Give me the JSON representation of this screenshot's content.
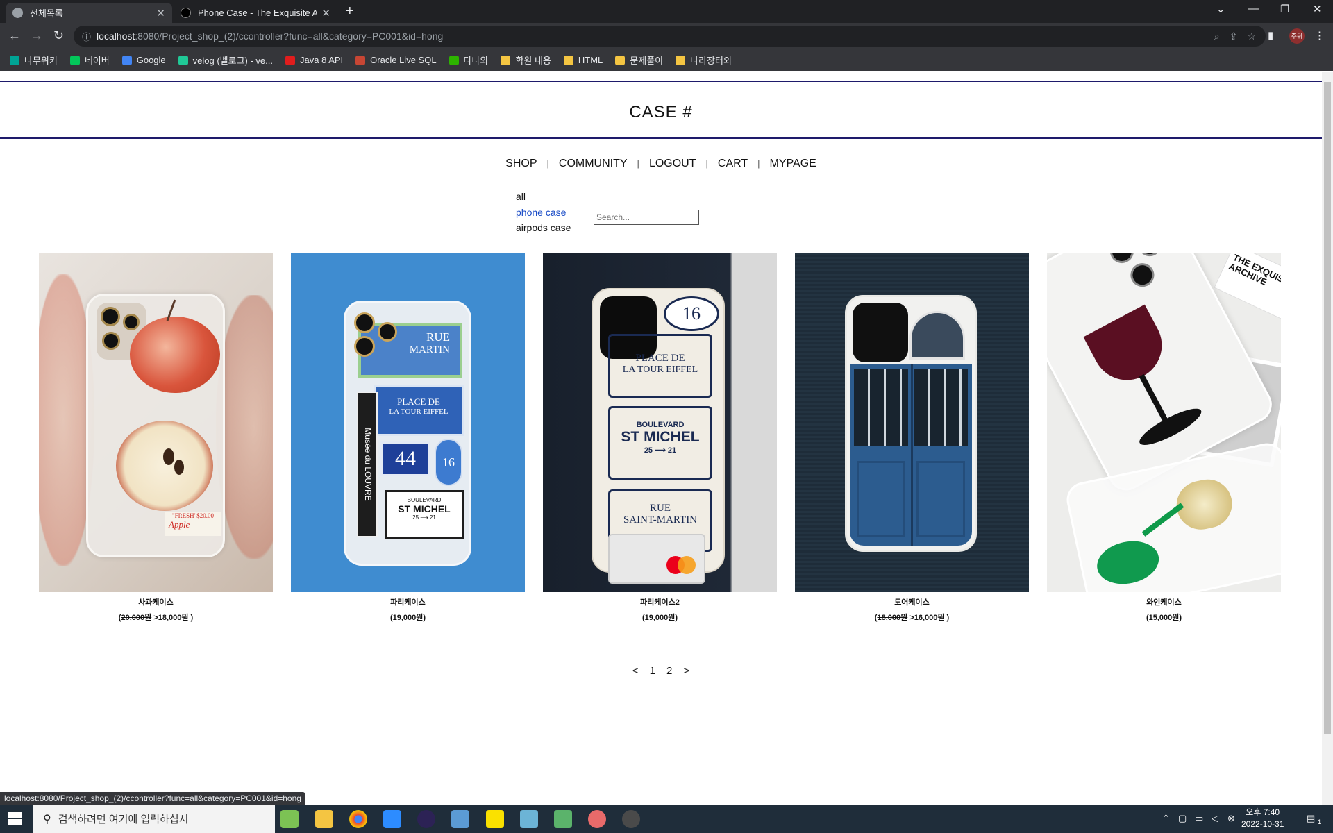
{
  "browser": {
    "tabs": [
      {
        "title": "전체목록",
        "active": true
      },
      {
        "title": "Phone Case - The Exquisite Arc",
        "active": false
      }
    ],
    "url_host": "localhost",
    "url_rest": ":8080/Project_shop_(2)/ccontroller?func=all&category=PC001&id=hong",
    "profile_label": "추워",
    "bookmarks": [
      {
        "label": "나무위키",
        "color": "#00a495"
      },
      {
        "label": "네이버",
        "color": "#03c75a"
      },
      {
        "label": "Google",
        "color": "#4285f4"
      },
      {
        "label": "velog (벨로그) - ve...",
        "color": "#20c997"
      },
      {
        "label": "Java 8 API",
        "color": "#e11d1d"
      },
      {
        "label": "Oracle Live SQL",
        "color": "#c74634"
      },
      {
        "label": "다나와",
        "color": "#2db400"
      },
      {
        "label": "학원 내용",
        "color": "#f4c542"
      },
      {
        "label": "HTML",
        "color": "#f4c542"
      },
      {
        "label": "문제풀이",
        "color": "#f4c542"
      },
      {
        "label": "나라장터외",
        "color": "#f4c542"
      }
    ],
    "status_url": "localhost:8080/Project_shop_(2)/ccontroller?func=all&category=PC001&id=hong"
  },
  "site": {
    "logo": "CASE #",
    "nav": [
      "SHOP",
      "COMMUNITY",
      "LOGOUT",
      "CART",
      "MYPAGE"
    ],
    "nav_separator": "|",
    "categories": {
      "all": "all",
      "phone": "phone case",
      "airpods": "airpods case"
    },
    "search_placeholder": "Search..."
  },
  "products": [
    {
      "name": "사과케이스",
      "price_old": "20,000원",
      "price_new": "18,000원 ",
      "sale": true
    },
    {
      "name": "파리케이스",
      "price": "(19,000원)",
      "sale": false
    },
    {
      "name": "파리케이스2",
      "price": "(19,000원)",
      "sale": false
    },
    {
      "name": "도어케이스",
      "price_old": "18,000원",
      "price_new": "16,000원 ",
      "sale": true
    },
    {
      "name": "와인케이스",
      "price": "(15,000원)",
      "sale": false
    }
  ],
  "case_text": {
    "apple_tag": "\"FRESH\"$20.00",
    "apple_word": "Apple",
    "paris_rue": "RUE",
    "paris_martin": "MARTIN",
    "paris_place": "PLACE DE",
    "paris_tour": "LA TOUR EIFFEL",
    "paris_44": "44",
    "paris_16": "16",
    "paris_louvre": "Musée du LOUVRE",
    "paris_boulevard": "BOULEVARD",
    "paris_stmichel": "ST MICHEL",
    "paris_25_21": "25 ⟶ 21",
    "paris2_16": "16",
    "paris2_place": "PLACE DE",
    "paris2_tour": "LA TOUR EIFFEL",
    "paris2_boulevard": "BOULEVARD",
    "paris2_stmichel": "ST MICHEL",
    "paris2_25_21": "25 ⟶ 21",
    "paris2_rue": "RUE",
    "paris2_saintmartin": "SAINT-MARTIN",
    "wine_brand": "THE EXQUIS ARCHIVE"
  },
  "pager": {
    "prev": "<",
    "pages": [
      "1",
      "2"
    ],
    "next": ">"
  },
  "taskbar": {
    "search_placeholder": "검색하려면 여기에 입력하십시",
    "time": "오후 7:40",
    "date": "2022-10-31",
    "notification_count": "1"
  }
}
